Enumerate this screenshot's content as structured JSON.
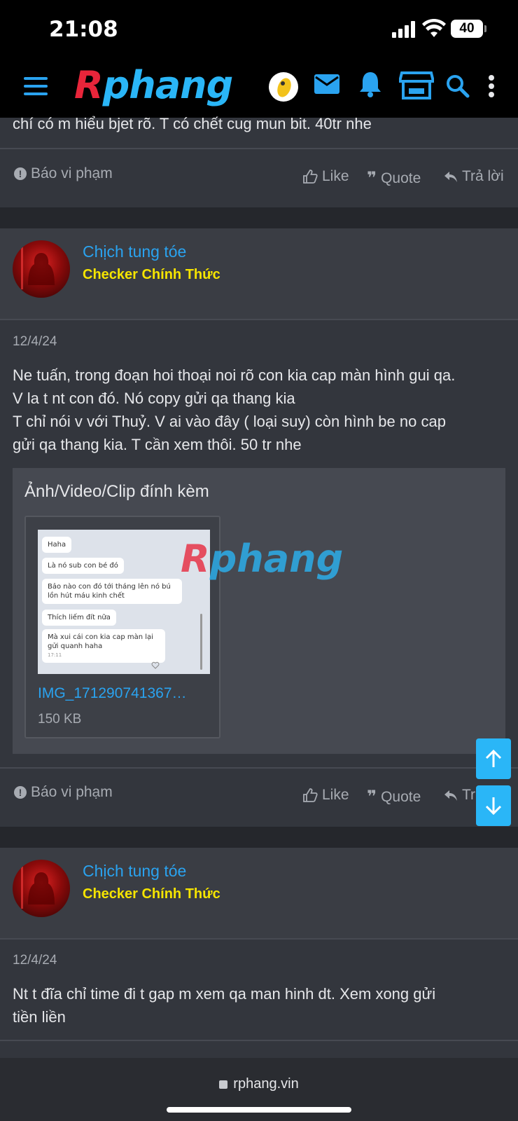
{
  "status_bar": {
    "time": "21:08",
    "battery": "40"
  },
  "header": {
    "logo_r": "R",
    "logo_rest": "phang"
  },
  "prev_post": {
    "text_tail": "chí có m hiểu bjet rõ. T có chết cug mun bit. 40tr nhe",
    "actions": {
      "report": "Báo vi phạm",
      "like": "Like",
      "quote": "Quote",
      "reply": "Trả lời"
    }
  },
  "posts": [
    {
      "username": "Chịch tung tóe",
      "user_title": "Checker Chính Thức",
      "date": "12/4/24",
      "body_lines": [
        "Ne tuấn, trong đoạn hoi thoại noi rõ con kia cap màn hình gui qa.",
        "V la t nt con đó. Nó copy gửi qa thang kia",
        "T chỉ nói v với Thuỷ. V ai vào đây ( loại suy) còn hình be no cap",
        "gửi qa thang kia. T cần xem thôi. 50 tr nhe"
      ],
      "attachments": {
        "title": "Ảnh/Video/Clip đính kèm",
        "file_name": "IMG_171290741367…",
        "file_size": "150 KB",
        "thumbnail_messages": [
          "Haha",
          "Là nó sub con bé đó",
          "Bảo nào con đó tới tháng lên nó bú lồn hút máu kinh chết",
          "Thích liếm đít nữa",
          "Mà xui cái con kia cap màn lại gửi quanh haha"
        ],
        "thumbnail_time": "17:11"
      },
      "actions": {
        "report": "Báo vi phạm",
        "like": "Like",
        "quote": "Quote",
        "reply": "Tr"
      }
    },
    {
      "username": "Chịch tung tóe",
      "user_title": "Checker Chính Thức",
      "date": "12/4/24",
      "body_lines": [
        "Nt t đĩa chỉ time đi t gap m xem qa man hinh dt. Xem xong gửi",
        "tiền liền"
      ]
    }
  ],
  "url_bar": {
    "url": "rphang.vin"
  },
  "colors": {
    "accent": "#2aa3f0",
    "user_title": "#f5e400",
    "logo_red": "#e8253a",
    "background": "#33363d"
  }
}
